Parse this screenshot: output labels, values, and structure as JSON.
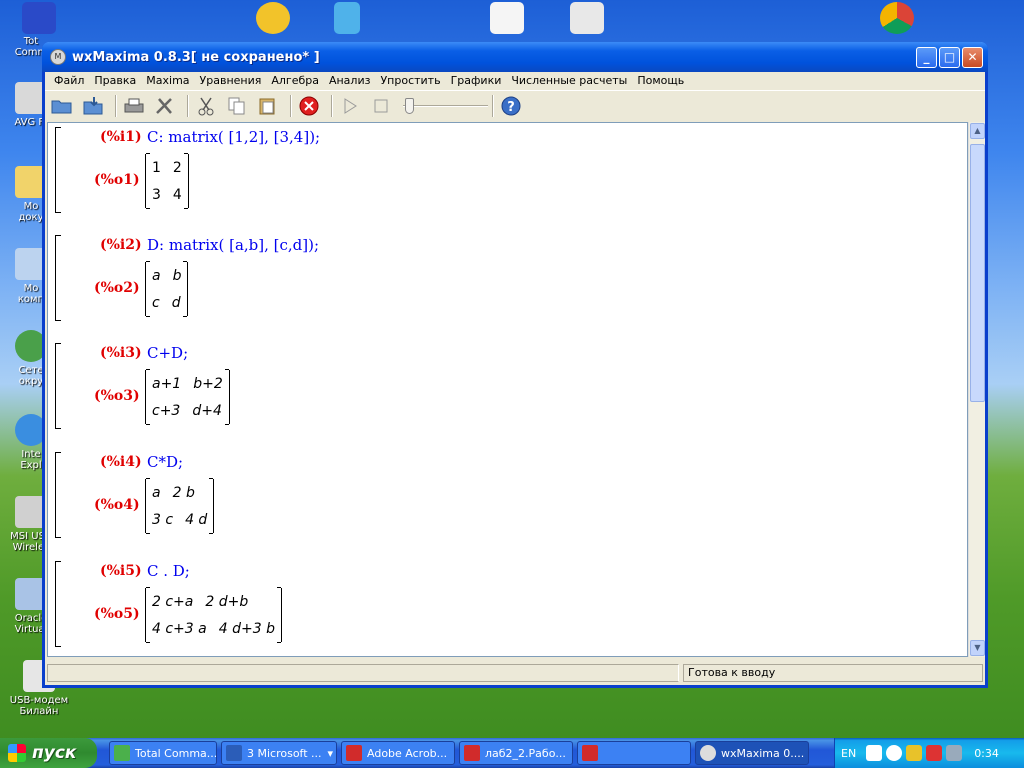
{
  "desktop": {
    "icons": [
      {
        "label": "Tot\nComm"
      },
      {
        "label": "AVG Fr"
      },
      {
        "label": "Мо\nдоку"
      },
      {
        "label": "Мо\nкомп"
      },
      {
        "label": "Сете\nокру"
      },
      {
        "label": "Inte\nExpl"
      },
      {
        "label": "MSI USB\nWireles"
      },
      {
        "label": "Oracle\nVirtual"
      },
      {
        "label": "USB-модем\nБилайн"
      }
    ]
  },
  "window": {
    "title": "wxMaxima 0.8.3[ не сохранено* ]",
    "title_icon": "M",
    "min": "_",
    "max": "□",
    "close": "✕"
  },
  "menu": [
    "Файл",
    "Правка",
    "Maxima",
    "Уравнения",
    "Алгебра",
    "Анализ",
    "Упростить",
    "Графики",
    "Численные расчеты",
    "Помощь"
  ],
  "cells": [
    {
      "in_label": "(%i1)",
      "input": "C: matrix( [1,2],  [3,4]);",
      "out_label": "(%o1)",
      "matrix": [
        [
          "1",
          "2"
        ],
        [
          "3",
          "4"
        ]
      ],
      "italic": false
    },
    {
      "in_label": "(%i2)",
      "input": "D: matrix( [a,b],  [c,d]);",
      "out_label": "(%o2)",
      "matrix": [
        [
          "a",
          "b"
        ],
        [
          "c",
          "d"
        ]
      ],
      "italic": true
    },
    {
      "in_label": "(%i3)",
      "input": "C+D;",
      "out_label": "(%o3)",
      "matrix": [
        [
          "a+1",
          "b+2"
        ],
        [
          "c+3",
          "d+4"
        ]
      ],
      "italic": true
    },
    {
      "in_label": "(%i4)",
      "input": "C*D;",
      "out_label": "(%o4)",
      "matrix": [
        [
          "a",
          "2 b"
        ],
        [
          "3 c",
          "4 d"
        ]
      ],
      "italic": true
    },
    {
      "in_label": "(%i5)",
      "input": "C . D;",
      "out_label": "(%o5)",
      "matrix": [
        [
          "2 c+a",
          "2 d+b"
        ],
        [
          "4 c+3 a",
          "4 d+3 b"
        ]
      ],
      "italic": true
    }
  ],
  "status": {
    "right": "Готова к вводу"
  },
  "taskbar": {
    "start": "пуск",
    "tasks": [
      "Total Comma...",
      "3 Microsoft ...",
      "Adobe Acrob...",
      "лаб2_2.Рабо...",
      "",
      "wxMaxima 0...."
    ],
    "lang": "EN",
    "clock": "0:34"
  },
  "colors": {
    "input_label": "#e00000",
    "input_text": "#0000ee",
    "titlebar": "#0052dc"
  }
}
